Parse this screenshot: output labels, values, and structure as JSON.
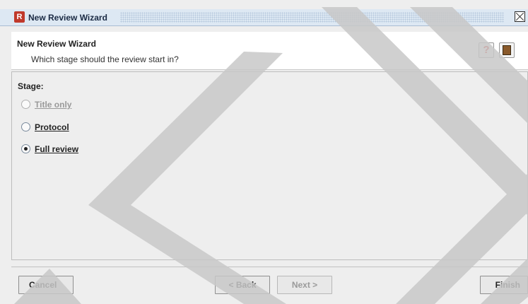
{
  "window": {
    "title": "New Review Wizard",
    "app_icon": "R",
    "close_icon": "close-icon"
  },
  "header": {
    "title": "New Review Wizard",
    "subtitle": "Which stage should the review start in?"
  },
  "stage": {
    "label": "Stage:",
    "options": [
      {
        "label": "Title only",
        "selected": false,
        "enabled": false
      },
      {
        "label": "Protocol",
        "selected": false,
        "enabled": true
      },
      {
        "label": "Full review",
        "selected": true,
        "enabled": true
      }
    ]
  },
  "buttons": {
    "cancel": "Cancel",
    "back": "< Back",
    "next": "Next >",
    "finish": "Finish"
  },
  "colors": {
    "titlebar": "#dde8f3",
    "background": "#eeeeee",
    "watermark": "#c8c8c8"
  }
}
